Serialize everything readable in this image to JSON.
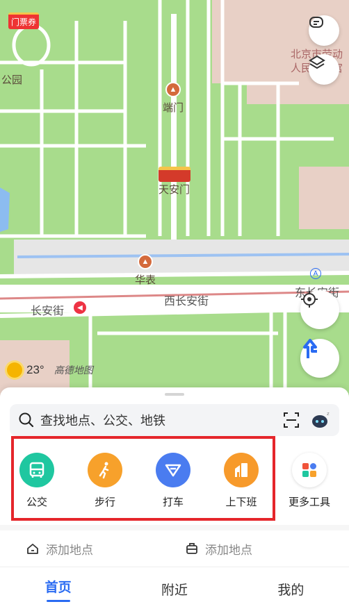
{
  "map": {
    "ticket_badge": "门票券",
    "labels": {
      "park": "公园",
      "duanmen": "端门",
      "tiananmen": "天安门",
      "huabiao": "华表",
      "xichangan": "西长安街",
      "changan": "长安街",
      "dongchangan": "东长安街",
      "museum": "北京市劳动人民文化宫"
    },
    "subway_badge": "A",
    "weather": {
      "icon": "sun-icon",
      "temp": "23°"
    },
    "logo": "高德地图",
    "buttons": [
      "message-icon",
      "layers-icon",
      "locate-icon",
      "navigation-icon"
    ],
    "colors": {
      "grass": "#a8dc8c",
      "road": "#ffffff",
      "building": "#e8d0c6",
      "bus_lane": "#7aaef0"
    }
  },
  "sheet": {
    "search_placeholder": "查找地点、公交、地铁",
    "tools": [
      {
        "label": "公交",
        "icon": "bus-icon",
        "color": "#1fc7a0"
      },
      {
        "label": "步行",
        "icon": "walk-icon",
        "color": "#f7a12b"
      },
      {
        "label": "打车",
        "icon": "taxi-icon",
        "color": "#4a7cf0"
      },
      {
        "label": "上下班",
        "icon": "commute-icon",
        "color": "#f79a2b"
      },
      {
        "label": "更多工具",
        "icon": "more-tools-icon",
        "color": "#ffffff"
      }
    ],
    "quick": [
      {
        "label": "添加地点",
        "icon": "home-icon"
      },
      {
        "label": "添加地点",
        "icon": "briefcase-icon"
      }
    ]
  },
  "tabs": [
    {
      "label": "首页",
      "active": true
    },
    {
      "label": "附近",
      "active": false
    },
    {
      "label": "我的",
      "active": false
    }
  ]
}
